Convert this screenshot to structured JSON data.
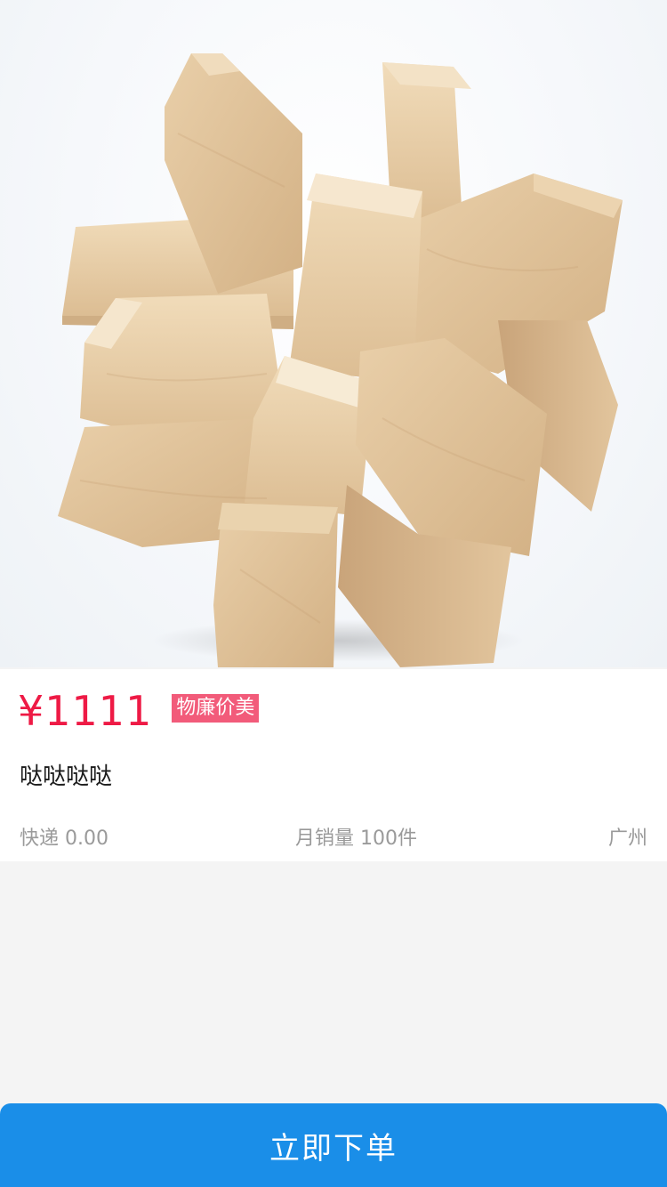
{
  "product": {
    "price": "¥1111",
    "tag": "物廉价美",
    "title": "哒哒哒哒",
    "shipping": "快递 0.00",
    "monthly_sales": "月销量 100件",
    "location": "广州"
  },
  "footer": {
    "order_label": "立即下单"
  },
  "colors": {
    "price": "#ee1a45",
    "tag_bg": "#f25b7a",
    "button_bg": "#1a8ee8"
  },
  "icons": {
    "product_image": "wooden-puzzle-image"
  }
}
